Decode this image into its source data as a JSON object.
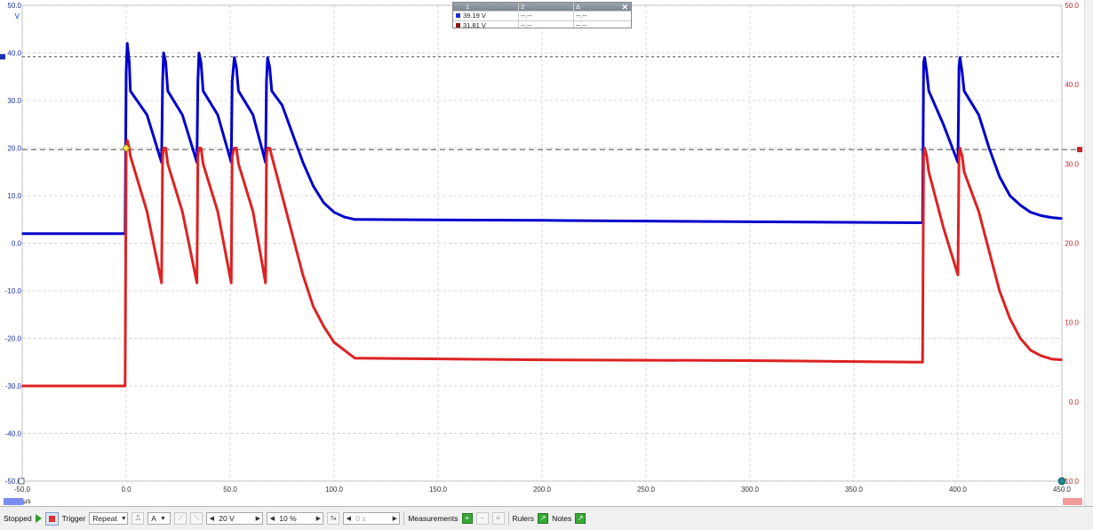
{
  "window": {
    "title": ""
  },
  "measurements_table": {
    "headers": [
      "1",
      "2",
      "Δ"
    ],
    "rows": [
      {
        "color": "#1f2fc4",
        "values": [
          "39.19 V",
          "--.--",
          "--.--"
        ]
      },
      {
        "color": "#8a1a1a",
        "values": [
          "31.81 V",
          "--.--",
          "--.--"
        ]
      }
    ]
  },
  "axes": {
    "x_unit": "μs",
    "x_ticks": [
      "-50.0",
      "0.0",
      "50.0",
      "100.0",
      "150.0",
      "200.0",
      "250.0",
      "300.0",
      "350.0",
      "400.0",
      "450.0"
    ],
    "left_unit": "V",
    "left_ticks": [
      "50.0",
      "40.0",
      "30.0",
      "20.0",
      "10.0",
      "0.0",
      "-10.0",
      "-20.0",
      "-30.0",
      "-40.0",
      "-50.0"
    ],
    "right_unit": "V",
    "right_ticks": [
      "50.0",
      "40.0",
      "30.0",
      "20.0",
      "10.0",
      "0.0",
      "-10.0"
    ]
  },
  "colors": {
    "channel_a": "#0000cc",
    "channel_b": "#dd2222",
    "grid": "#c8c8c8",
    "ruler": "#555555"
  },
  "chart_data": {
    "type": "line",
    "title": "",
    "xlabel": "μs",
    "ylabel": "V",
    "xlim": [
      -50,
      450
    ],
    "grid": true,
    "rulers": {
      "channel_a": 39.19,
      "channel_b": 31.81
    },
    "series": [
      {
        "name": "",
        "axis": "left",
        "ylim": [
          -50,
          50
        ],
        "x": [
          -50,
          -0.5,
          0,
          0.5,
          1.5,
          2,
          10,
          17,
          17.5,
          18,
          19,
          20,
          27,
          34,
          34.5,
          35,
          36,
          37,
          44,
          50.5,
          51,
          52,
          53,
          54,
          61,
          67,
          67.5,
          68,
          69,
          70,
          75,
          80,
          85,
          90,
          95,
          100,
          105,
          110,
          200,
          300,
          383,
          383.5,
          384,
          385,
          386,
          393,
          400,
          400.5,
          401,
          402,
          403,
          410,
          415,
          420,
          425,
          430,
          435,
          440,
          445,
          450
        ],
        "values": [
          2,
          2,
          36,
          42,
          38,
          32,
          27,
          17,
          34,
          40,
          38,
          32,
          27,
          17,
          34,
          40,
          38,
          32,
          27,
          17,
          34,
          39,
          37,
          32,
          27,
          17,
          34,
          39,
          37,
          32,
          29,
          23,
          17,
          12,
          8.5,
          6.5,
          5.5,
          5,
          4.8,
          4.5,
          4.3,
          38,
          39,
          36,
          32,
          25,
          17,
          37,
          39,
          36,
          32,
          27,
          20,
          14,
          10,
          8,
          6.5,
          5.8,
          5.4,
          5.2
        ]
      },
      {
        "name": "",
        "axis": "right",
        "ylim": [
          -10,
          50
        ],
        "x": [
          -50,
          -0.5,
          0,
          0.5,
          1.5,
          2,
          10,
          17,
          17.5,
          18,
          19,
          20,
          27,
          34,
          34.5,
          35,
          36,
          37,
          44,
          50.5,
          51,
          52,
          53,
          54,
          61,
          67,
          67.5,
          68,
          69,
          70,
          75,
          80,
          85,
          90,
          95,
          100,
          105,
          110,
          200,
          300,
          383,
          383.5,
          384,
          385,
          386,
          393,
          400,
          400.5,
          401,
          402,
          403,
          410,
          415,
          420,
          425,
          430,
          435,
          440,
          445,
          450
        ],
        "values": [
          2,
          2,
          32,
          33,
          32,
          31,
          24,
          15,
          31,
          32,
          32,
          30,
          24,
          15,
          31,
          32,
          32,
          30,
          24,
          15,
          31,
          32,
          32,
          30,
          24,
          15,
          31,
          32,
          32,
          31,
          26,
          21,
          16,
          12,
          9.5,
          7.5,
          6.5,
          5.5,
          5.3,
          5.2,
          5,
          31,
          32,
          31,
          29,
          22,
          16,
          31,
          32,
          31,
          29,
          24,
          19,
          14,
          10.5,
          8,
          6.5,
          5.8,
          5.4,
          5.3
        ]
      }
    ]
  },
  "toolbar": {
    "status": "Stopped",
    "trigger_label": "Trigger",
    "trigger_mode": "Repeat",
    "trigger_source": "A",
    "threshold_value": "20 V",
    "pretrigger_value": "10 %",
    "delay_value": "0 s",
    "measurements_label": "Measurements",
    "rulers_label": "Rulers",
    "notes_label": "Notes"
  }
}
